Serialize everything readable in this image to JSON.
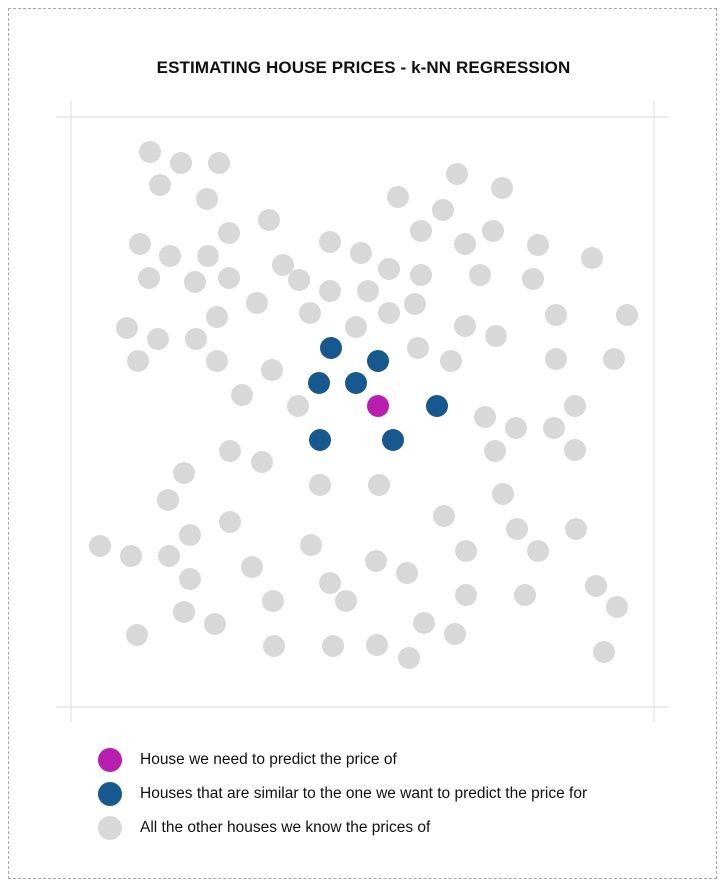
{
  "title": "ESTIMATING HOUSE PRICES - k-NN REGRESSION",
  "colors": {
    "target": "#b81fb0",
    "neighbor": "#17588f",
    "other": "#d8d8d8",
    "frame_line": "#e2e2e2"
  },
  "legend": [
    {
      "label": "House we need to predict the price of",
      "color": "#b81fb0"
    },
    {
      "label": "Houses that are similar to the one we want to predict the price for",
      "color": "#17588f"
    },
    {
      "label": "All the other houses we know the prices of",
      "color": "#d8d8d8"
    }
  ]
}
